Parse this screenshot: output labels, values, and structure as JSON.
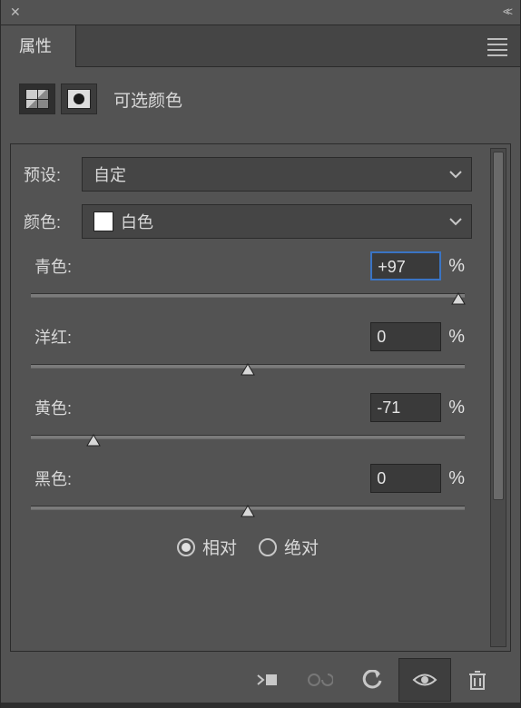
{
  "panel": {
    "title": "属性",
    "adjustment_name": "可选颜色"
  },
  "preset": {
    "label": "预设:",
    "value": "自定"
  },
  "colors": {
    "label": "颜色:",
    "value": "白色"
  },
  "sliders": {
    "cyan": {
      "label": "青色:",
      "value": "+97",
      "pos": 97,
      "unit": "%",
      "focused": true
    },
    "magenta": {
      "label": "洋红:",
      "value": "0",
      "pos": 0,
      "unit": "%",
      "focused": false
    },
    "yellow": {
      "label": "黄色:",
      "value": "-71",
      "pos": -71,
      "unit": "%",
      "focused": false
    },
    "black": {
      "label": "黑色:",
      "value": "0",
      "pos": 0,
      "unit": "%",
      "focused": false
    }
  },
  "method": {
    "relative": "相对",
    "absolute": "绝对",
    "selected": "relative"
  }
}
